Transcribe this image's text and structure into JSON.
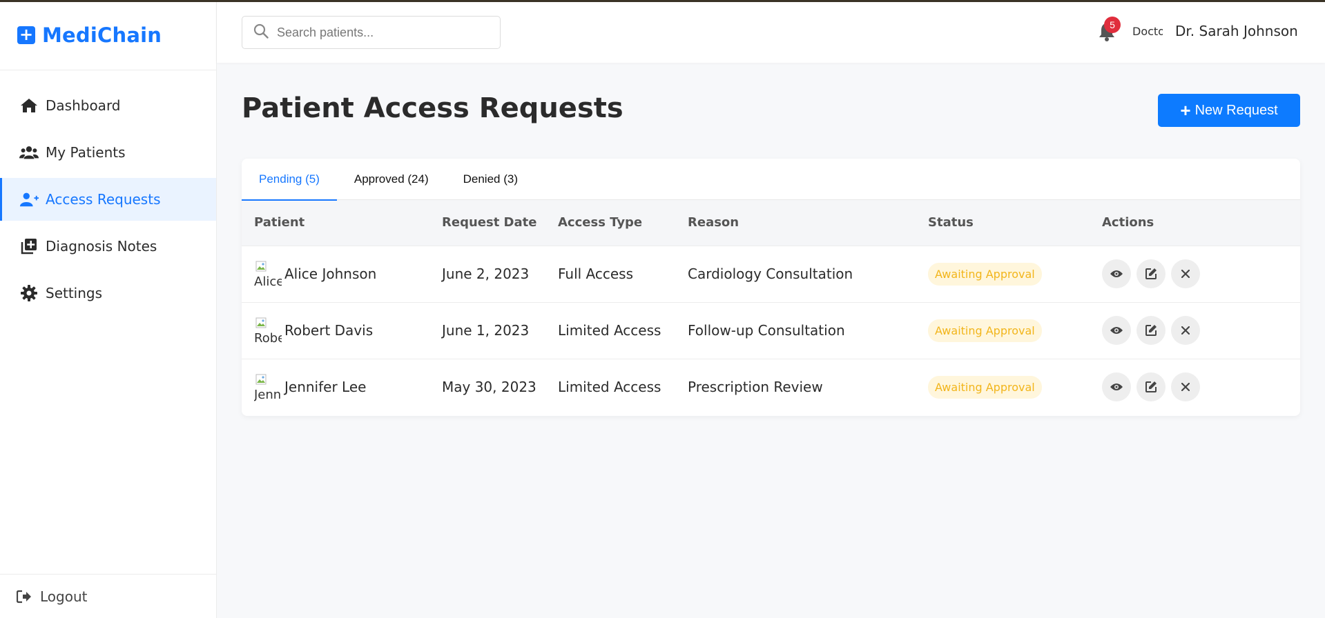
{
  "app": {
    "brand": "MediChain"
  },
  "sidebar": {
    "items": [
      {
        "label": "Dashboard",
        "icon": "home-icon"
      },
      {
        "label": "My Patients",
        "icon": "users-icon"
      },
      {
        "label": "Access Requests",
        "icon": "user-plus-icon",
        "active": true
      },
      {
        "label": "Diagnosis Notes",
        "icon": "notes-plus-icon"
      },
      {
        "label": "Settings",
        "icon": "gear-icon"
      }
    ],
    "logout": "Logout"
  },
  "header": {
    "search_placeholder": "Search patients...",
    "notification_count": "5",
    "avatar_alt": "Doctor",
    "user_name": "Dr. Sarah Johnson"
  },
  "main": {
    "title": "Patient Access Requests",
    "new_request_label": "New Request",
    "tabs": [
      {
        "label": "Pending (5)",
        "active": true
      },
      {
        "label": "Approved (24)"
      },
      {
        "label": "Denied (3)"
      }
    ],
    "columns": [
      "Patient",
      "Request Date",
      "Access Type",
      "Reason",
      "Status",
      "Actions"
    ],
    "rows": [
      {
        "patient": "Alice Johnson",
        "avatar_alt": "Alice Johnson",
        "date": "June 2, 2023",
        "access": "Full Access",
        "reason": "Cardiology Consultation",
        "status": "Awaiting Approval"
      },
      {
        "patient": "Robert Davis",
        "avatar_alt": "Robert Davis",
        "date": "June 1, 2023",
        "access": "Limited Access",
        "reason": "Follow-up Consultation",
        "status": "Awaiting Approval"
      },
      {
        "patient": "Jennifer Lee",
        "avatar_alt": "Jennifer Lee",
        "date": "May 30, 2023",
        "access": "Limited Access",
        "reason": "Prescription Review",
        "status": "Awaiting Approval"
      }
    ]
  },
  "colors": {
    "accent": "#1677ff",
    "button": "#0d7bff",
    "badge": "#e02d3c",
    "status_text": "#f2b51b",
    "status_bg": "#fff6dc"
  }
}
